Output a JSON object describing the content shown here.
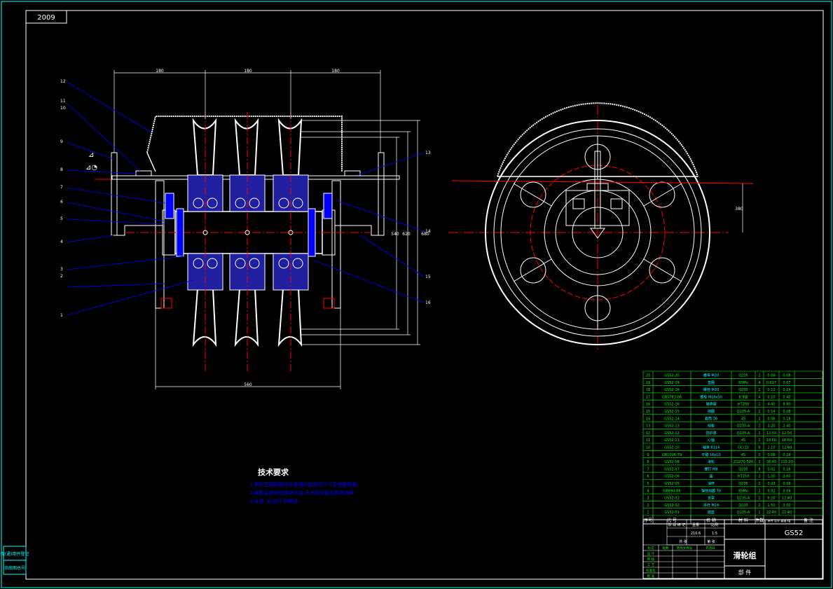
{
  "drawing": {
    "top_left_code": "2009",
    "tech_title": "技术要求",
    "tech_notes": [
      "1.滑轮在装配前应检查滑轮各部位尺寸及表面质量.",
      "2.装配后滑轮应转动灵活,无卡阻现象及异常响声.",
      "3.涂漆: 红色丹 防锈漆."
    ],
    "part_title": "滑轮组",
    "part_sub": "部 件",
    "drawing_no": "GS52",
    "bom_header": [
      "序号",
      "代 号",
      "名 称",
      "材 料",
      "件数",
      "单件 总计 重量 kg",
      "备 注"
    ],
    "bom_rows": [
      [
        "20",
        "GS52-20",
        "螺母 M20",
        "Q235",
        "2",
        "0.04",
        "0.08"
      ],
      [
        "19",
        "GS52-19",
        "垫圈",
        "65Mn",
        "4",
        "0.017",
        "0.07"
      ],
      [
        "18",
        "GS52-18",
        "螺栓 M20",
        "Q235",
        "2",
        "0.12",
        "0.24"
      ],
      [
        "17",
        "GB5783-86",
        "螺栓 M16x50",
        "8.8级",
        "4",
        "0.10",
        "0.40"
      ],
      [
        "16",
        "GS52-16",
        "轴承座",
        "HT200",
        "2",
        "4.40",
        "8.80"
      ],
      [
        "15",
        "GS52-15",
        "挡圈",
        "Q235-A",
        "2",
        "0.14",
        "0.28"
      ],
      [
        "14",
        "GS52-14",
        "套筒 30",
        "45",
        "3",
        "0.06",
        "0.18"
      ],
      [
        "13",
        "GS52-13",
        "挡板",
        "Q235-A",
        "2",
        "1.20",
        "2.40"
      ],
      [
        "12",
        "GS52-12",
        "防护罩",
        "Q235-A",
        "1",
        "12.50",
        "12.50"
      ],
      [
        "11",
        "GS52-11",
        "心轴",
        "45",
        "1",
        "18.60",
        "18.60"
      ],
      [
        "10",
        "GS52-10",
        "轴承 6314",
        "GCr15",
        "6",
        "2.10",
        "12.60"
      ],
      [
        "9",
        "GB1096-79",
        "平键 16x10",
        "45",
        "3",
        "0.08",
        "0.24"
      ],
      [
        "8",
        "GS52-08",
        "滑轮",
        "ZG270-500",
        "3",
        "38.40",
        "115.20"
      ],
      [
        "7",
        "GS52-07",
        "螺钉 M8",
        "Q235",
        "8",
        "0.02",
        "0.16"
      ],
      [
        "6",
        "GS52-06",
        "盖",
        "HT150",
        "2",
        "1.30",
        "2.60"
      ],
      [
        "5",
        "GS52-05",
        "油杯",
        "Q235",
        "2",
        "0.03",
        "0.06"
      ],
      [
        "4",
        "GB894-86",
        "弹性挡圈 70",
        "65Mn",
        "2",
        "0.02",
        "0.04"
      ],
      [
        "3",
        "GS52-03",
        "支架",
        "Q235-A",
        "2",
        "6.20",
        "12.40"
      ],
      [
        "2",
        "GS52-02",
        "吊杆 M24",
        "Q235",
        "2",
        "1.50",
        "3.00"
      ],
      [
        "1",
        "GS52-01",
        "底座",
        "Q235-A",
        "1",
        "22.40",
        "22.40"
      ]
    ],
    "title_block": {
      "row1": [
        "阶 段 标 记",
        "重量",
        "比例"
      ],
      "weight": "210.6",
      "scale": "1:5",
      "row2": [
        "共 张",
        "第 张"
      ],
      "sign_rows": [
        "标记",
        "处数",
        "分区",
        "更改文件号",
        "签名",
        "年月日"
      ],
      "roles": [
        "设 计",
        "审 核",
        "工 艺",
        "标准化",
        "批 准"
      ]
    },
    "left_stamp": [
      "借(通)用件登记",
      "旧底图总号"
    ],
    "balloons_left": [
      "12",
      "11",
      "10",
      "9",
      "8",
      "7",
      "6",
      "5",
      "4",
      "3",
      "2",
      "1"
    ],
    "balloons_right": [
      "13",
      "14",
      "15",
      "16"
    ],
    "dim_top": [
      "180",
      "180",
      "180"
    ],
    "dim_bottom": "560",
    "dim_right": [
      "540",
      "620",
      "680"
    ],
    "dim_side": "380"
  },
  "colors": {
    "outline": "#ffffff",
    "dim": "#00ffff",
    "table": "#00ff00",
    "center": "#ff0000",
    "hatch": "#0000ff",
    "leader": "#0000ff",
    "bearing": "#ff00ff"
  }
}
